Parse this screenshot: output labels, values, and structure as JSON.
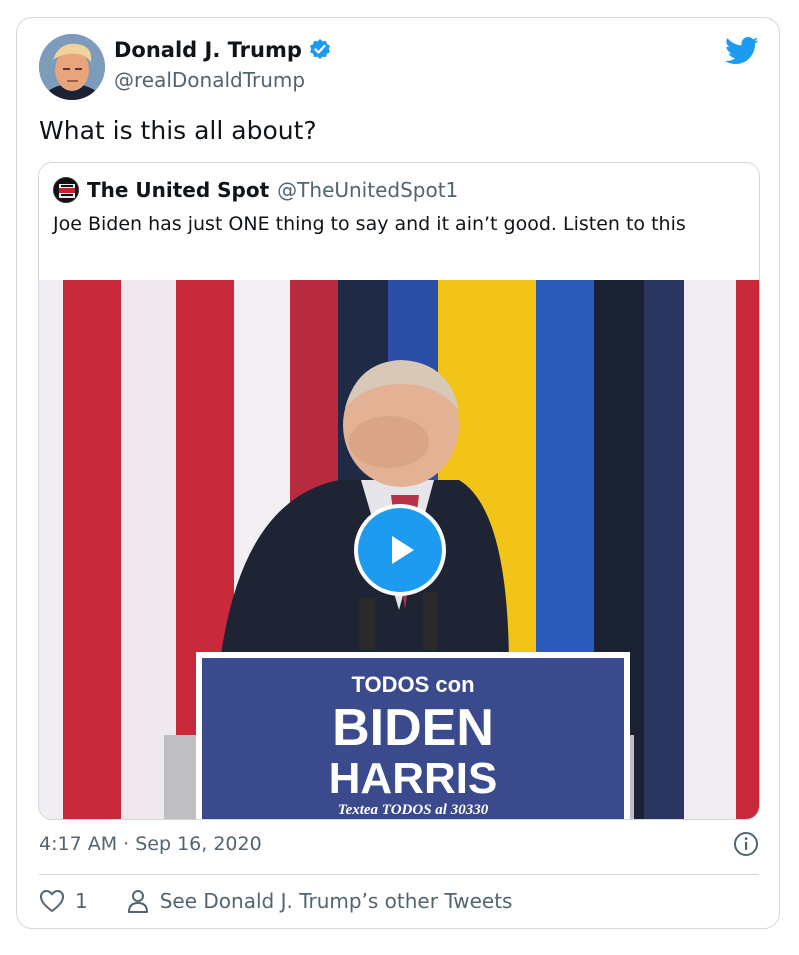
{
  "tweet": {
    "author_name": "Donald J. Trump",
    "author_handle": "@realDonaldTrump",
    "text": "What is this all about?",
    "time": "4:17 AM · Sep 16, 2020",
    "like_count": "1",
    "other_tweets_label": "See Donald J. Trump’s other Tweets"
  },
  "quoted": {
    "avatar_label": "THE UNITED SPOT",
    "name": "The United Spot",
    "handle": "@TheUnitedSpot1",
    "text": "Joe Biden has just ONE thing to say and it ain’t good. Listen to this"
  },
  "video": {
    "sign_line1": "TODOS con",
    "sign_line2": "BIDEN",
    "sign_line3": "HARRIS",
    "sign_line4": "Textea TODOS al 30330"
  },
  "colors": {
    "accent": "#1d9bf0",
    "text_primary": "#0f1419",
    "text_secondary": "#536471",
    "border": "#cfd9de"
  },
  "icons": [
    "twitter-bird-icon",
    "verified-badge-icon",
    "play-icon",
    "info-icon",
    "heart-icon",
    "person-icon"
  ]
}
